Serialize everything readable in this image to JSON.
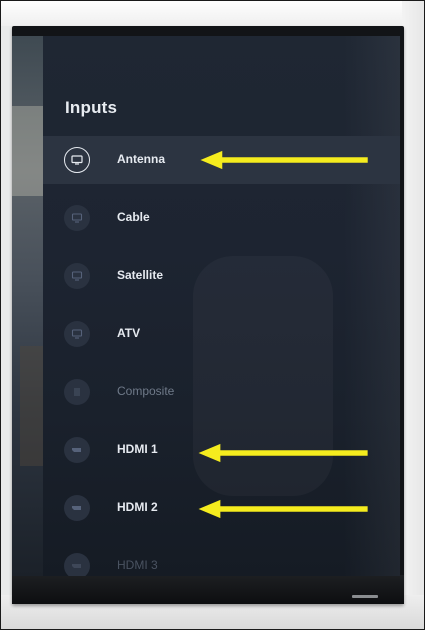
{
  "panel": {
    "title": "Inputs",
    "items": [
      {
        "label": "Antenna",
        "icon": "tv-icon",
        "state": "focused"
      },
      {
        "label": "Cable",
        "icon": "tv-icon",
        "state": "normal"
      },
      {
        "label": "Satellite",
        "icon": "tv-icon",
        "state": "normal"
      },
      {
        "label": "ATV",
        "icon": "tv-icon",
        "state": "normal"
      },
      {
        "label": "Composite",
        "icon": "composite-icon",
        "state": "disabled"
      },
      {
        "label": "HDMI 1",
        "icon": "hdmi-icon",
        "state": "normal"
      },
      {
        "label": "HDMI 2",
        "icon": "hdmi-icon",
        "state": "normal"
      },
      {
        "label": "HDMI 3",
        "icon": "hdmi-icon",
        "state": "faded"
      }
    ]
  },
  "colors": {
    "panel_bg": "#1d2431",
    "focused_row": "#2c3441",
    "text": "#e6eaf0",
    "arrow": "#f5ec1e"
  }
}
